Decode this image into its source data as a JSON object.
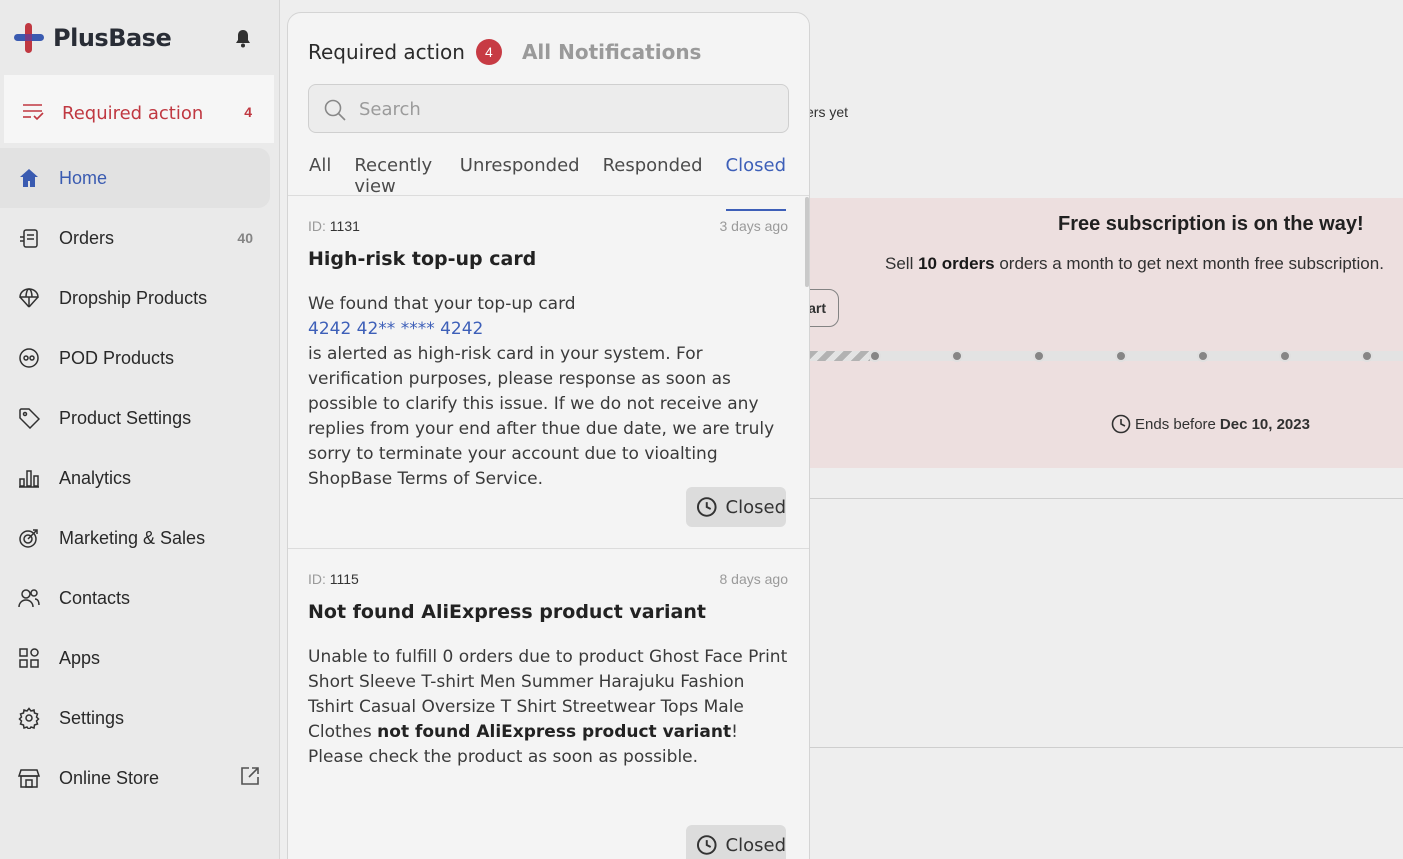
{
  "brand": {
    "name": "PlusBase"
  },
  "sidebar": {
    "required_action": {
      "label": "Required action",
      "count": "4"
    },
    "items": [
      {
        "label": "Home",
        "icon": "home-icon",
        "active": true
      },
      {
        "label": "Orders",
        "icon": "orders-icon",
        "count": "40"
      },
      {
        "label": "Dropship Products",
        "icon": "parachute-icon"
      },
      {
        "label": "POD Products",
        "icon": "pod-icon"
      },
      {
        "label": "Product Settings",
        "icon": "tag-icon"
      },
      {
        "label": "Analytics",
        "icon": "bar-chart-icon"
      },
      {
        "label": "Marketing & Sales",
        "icon": "target-icon"
      },
      {
        "label": "Contacts",
        "icon": "users-icon"
      },
      {
        "label": "Apps",
        "icon": "apps-grid-icon"
      },
      {
        "label": "Settings",
        "icon": "gear-icon"
      },
      {
        "label": "Online Store",
        "icon": "store-icon"
      }
    ]
  },
  "main": {
    "orders_text": "ers yet",
    "promo": {
      "title": "Free subscription is on the way!",
      "sub_prefix": "Sell ",
      "sub_bold": "10 orders",
      "sub_suffix": " orders a month to get next month free subscription.",
      "start_label": "art",
      "ends_prefix": "Ends before",
      "ends_date": "Dec 10, 2023"
    }
  },
  "panel": {
    "title": "Required action",
    "badge": "4",
    "all_notifications": "All Notifications",
    "search_placeholder": "Search",
    "tabs": [
      "All",
      "Recently view",
      "Unresponded",
      "Responded",
      "Closed"
    ],
    "active_tab": "Closed",
    "cards": [
      {
        "id_label": "ID:",
        "id": "1131",
        "time": "3 days ago",
        "title": "High-risk top-up card",
        "body_intro": "We found that your top-up card",
        "card_number": "4242 42** **** 4242",
        "body_rest": "is alerted as high-risk card in your system. For verification purposes, please response as soon as possible to clarify this issue. If we do not receive any replies from your end after thue due date, we are truly sorry to terminate your account due to vioalting ShopBase Terms of Service.",
        "status": "Closed"
      },
      {
        "id_label": "ID:",
        "id": "1115",
        "time": "8 days ago",
        "title": "Not found AliExpress product variant",
        "body_intro": "Unable to fulfill 0 orders due to product Ghost Face Print Short Sleeve T-shirt Men Summer Harajuku Fashion Tshirt Casual Oversize T Shirt Streetwear Tops Male Clothes ",
        "body_bold": "not found AliExpress product variant",
        "body_rest": "! Please check the product as soon as possible.",
        "status": "Closed"
      }
    ]
  },
  "colors": {
    "accent": "#3d5fb8",
    "alert": "#c73b44"
  }
}
